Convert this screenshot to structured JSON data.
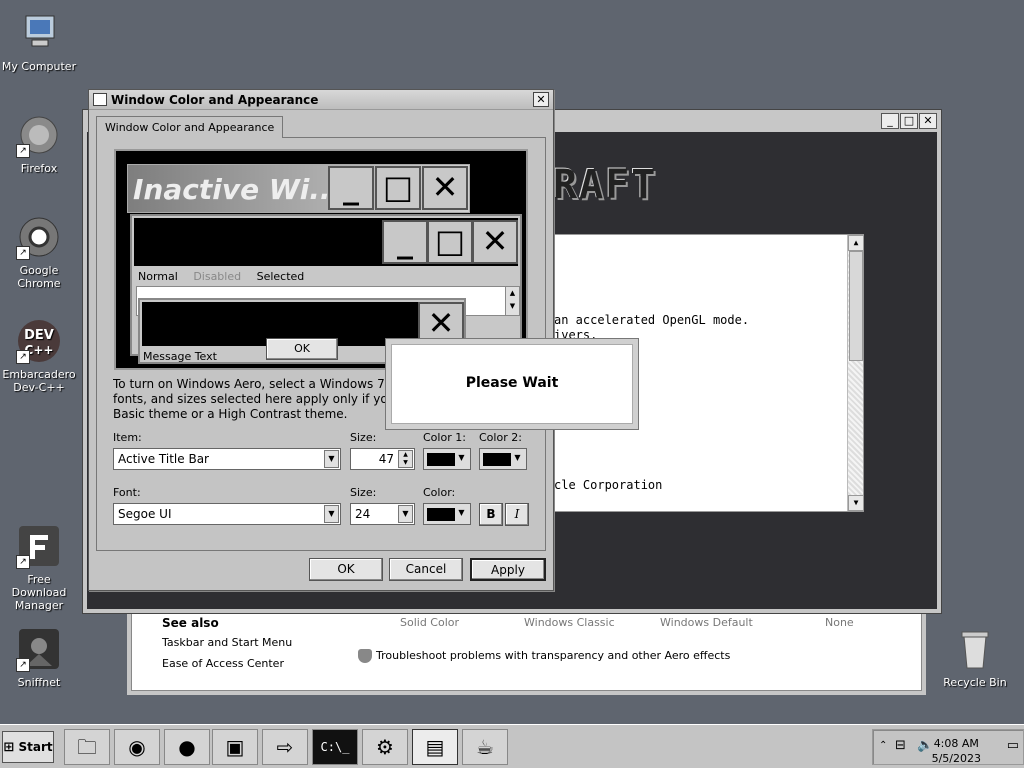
{
  "desktop": {
    "icons": [
      {
        "label": "My Computer",
        "icon": "computer-icon"
      },
      {
        "label": "Firefox",
        "icon": "firefox-icon"
      },
      {
        "label": "Google Chrome",
        "icon": "chrome-icon"
      },
      {
        "label": "Embarcadero Dev-C++",
        "icon": "devcpp-icon",
        "glyph": "DEV C++"
      },
      {
        "label": "Free Download Manager",
        "icon": "fdm-icon"
      },
      {
        "label": "Sniffnet",
        "icon": "sniffnet-icon"
      },
      {
        "label": "Recycle Bin",
        "icon": "recycle-bin-icon"
      }
    ]
  },
  "back_window": {
    "logo": "RAFT",
    "log_lines": [
      " an accelerated OpenGL mode.",
      "ivers.",
      "cle Corporation"
    ]
  },
  "personalization": {
    "see_also": "See also",
    "links": [
      "Taskbar and Start Menu",
      "Ease of Access Center"
    ],
    "troubleshoot": "Troubleshoot problems with transparency and other Aero effects",
    "themes": [
      "Solid Color",
      "Windows Classic",
      "Windows Default",
      "None"
    ]
  },
  "dialog": {
    "title": "Window Color and Appearance",
    "tab": "Window Color and Appearance",
    "preview": {
      "inactive_title": "Inactive Wi...",
      "menu": [
        "Normal",
        "Disabled",
        "Selected"
      ],
      "message_text": "Message Text",
      "ok": "OK"
    },
    "description": [
      "To turn on Windows Aero, select a Windows 7 them",
      "fonts, and sizes selected here apply only if you have",
      "Basic theme or a High Contrast theme."
    ],
    "item_label": "Item:",
    "item_value": "Active Title Bar",
    "size_label": "Size:",
    "size_value": "47",
    "color1_label": "Color 1:",
    "color2_label": "Color 2:",
    "font_label": "Font:",
    "font_value": "Segoe UI",
    "font_size_label": "Size:",
    "font_size_value": "24",
    "font_color_label": "Color:",
    "bold": "B",
    "italic": "I",
    "buttons": {
      "ok": "OK",
      "cancel": "Cancel",
      "apply": "Apply"
    }
  },
  "wait_dialog": {
    "text": "Please Wait"
  },
  "taskbar": {
    "start": "Start",
    "clock_time": "4:08 AM",
    "clock_date": "5/5/2023"
  }
}
